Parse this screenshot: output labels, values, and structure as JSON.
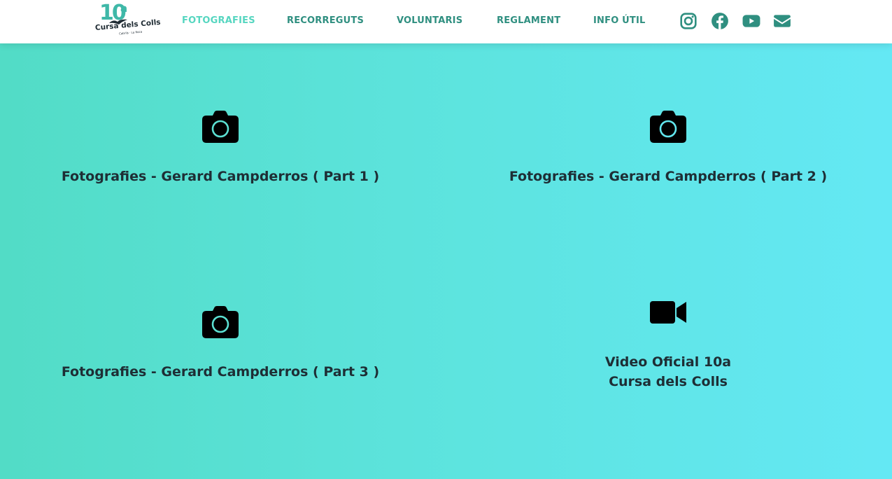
{
  "header": {
    "logo": {
      "number": "10",
      "superscript": "a",
      "name": "Cursa dels Colls",
      "tagline": "Cabrils · La Roca"
    },
    "nav": [
      {
        "label": "FOTOGRAFIES",
        "active": true
      },
      {
        "label": "RECORREGUTS",
        "active": false
      },
      {
        "label": "VOLUNTARIS",
        "active": false
      },
      {
        "label": "REGLAMENT",
        "active": false
      },
      {
        "label": "INFO ÚTIL",
        "active": false
      }
    ],
    "social": [
      "instagram-icon",
      "facebook-icon",
      "youtube-icon",
      "envelope-icon"
    ]
  },
  "cards": [
    {
      "icon": "camera-icon",
      "title": "Fotografies - Gerard Campderros ( Part 1 )"
    },
    {
      "icon": "camera-icon",
      "title": "Fotografies - Gerard Campderros ( Part 2 )"
    },
    {
      "icon": "camera-icon",
      "title": "Fotografies - Gerard Campderros ( Part 3 )"
    },
    {
      "icon": "video-camera-icon",
      "title_line1": "Video Oficial 10a",
      "title_line2": "Cursa dels Colls"
    }
  ],
  "colors": {
    "accent": "#56d6c0",
    "nav_text": "#2f8f80",
    "background_start": "#52dcc6",
    "background_end": "#64e8f4",
    "title_text": "#1e2e35"
  }
}
